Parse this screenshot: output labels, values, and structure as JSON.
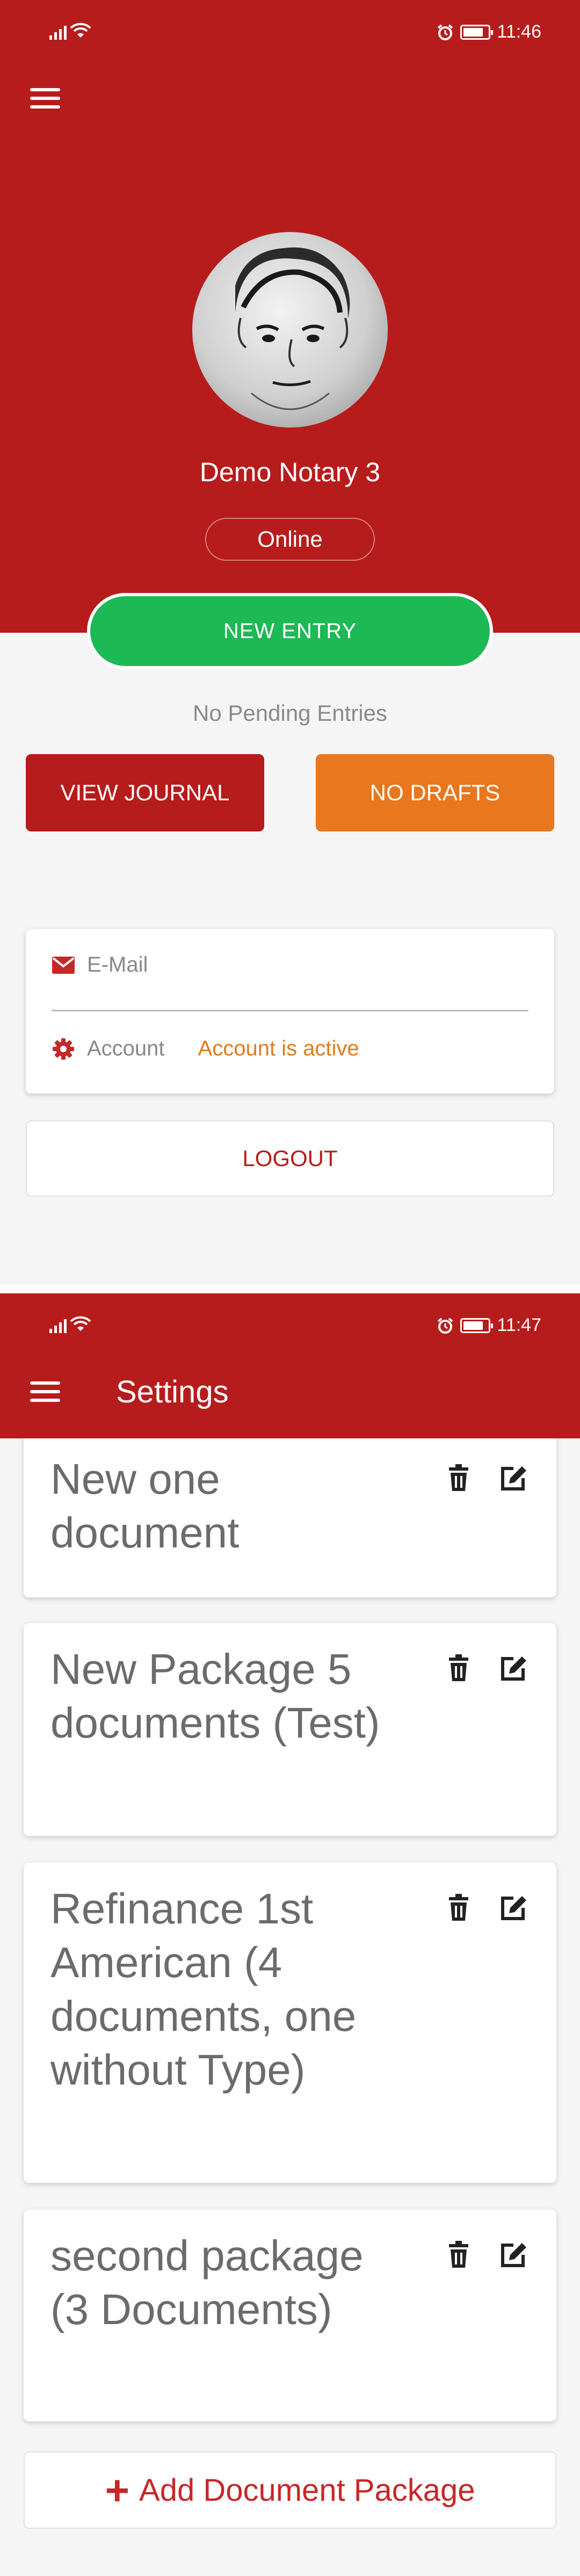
{
  "screen1": {
    "status_bar": {
      "time": "11:46"
    },
    "profile": {
      "name": "Demo  Notary 3",
      "status": "Online"
    },
    "actions": {
      "new_entry": "NEW ENTRY",
      "pending": "No Pending Entries",
      "view_journal": "VIEW JOURNAL",
      "drafts": "NO DRAFTS"
    },
    "account_card": {
      "email_placeholder": "E-Mail",
      "account_label": "Account",
      "account_status": "Account is active"
    },
    "logout": "LOGOUT"
  },
  "screen2": {
    "status_bar": {
      "time": "11:47"
    },
    "title": "Settings",
    "packages": [
      {
        "title": "New one document"
      },
      {
        "title": "New Package 5 documents (Test)"
      },
      {
        "title": "Refinance 1st American (4 documents, one without Type)"
      },
      {
        "title": "second package (3 Documents)"
      }
    ],
    "add_button": "Add Document Package"
  },
  "colors": {
    "primary_red": "#b71c1c",
    "accent_green": "#1db954",
    "accent_orange": "#e8771d",
    "status_active": "#e07b1f"
  },
  "icons": [
    "menu-icon",
    "mail-icon",
    "gear-icon",
    "trash-icon",
    "edit-icon",
    "plus-icon",
    "wifi-icon",
    "signal-icon",
    "alarm-icon",
    "battery-icon"
  ]
}
